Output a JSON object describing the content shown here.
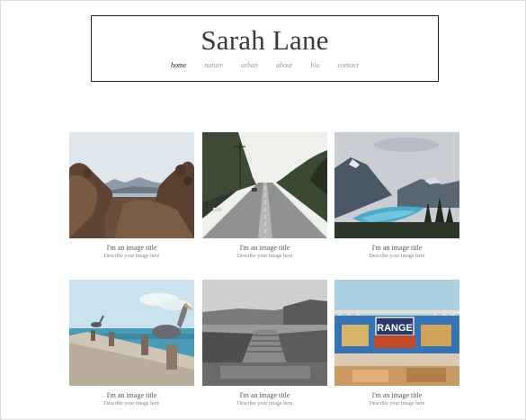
{
  "site": {
    "title": "Sarah Lane",
    "nav": [
      {
        "label": "home",
        "active": true
      },
      {
        "label": "nature",
        "active": false
      },
      {
        "label": "urban",
        "active": false
      },
      {
        "label": "about",
        "active": false
      },
      {
        "label": "bio",
        "active": false
      },
      {
        "label": "contact",
        "active": false
      }
    ]
  },
  "gallery": {
    "items": [
      {
        "title": "I'm an image title",
        "desc": "Describe your image here",
        "image": "hills-foliage-photo"
      },
      {
        "title": "I'm an image title",
        "desc": "Describe your image here",
        "image": "tree-lined-road-photo"
      },
      {
        "title": "I'm an image title",
        "desc": "Describe your image here",
        "image": "mountain-lake-photo"
      },
      {
        "title": "I'm an image title",
        "desc": "Describe your image here",
        "image": "pelicans-pier-photo"
      },
      {
        "title": "I'm an image title",
        "desc": "Describe your image here",
        "image": "boardwalk-field-photo"
      },
      {
        "title": "I'm an image title",
        "desc": "Describe your image here",
        "image": "range-sign-stall-photo"
      }
    ],
    "sign_text": "RANGE"
  }
}
